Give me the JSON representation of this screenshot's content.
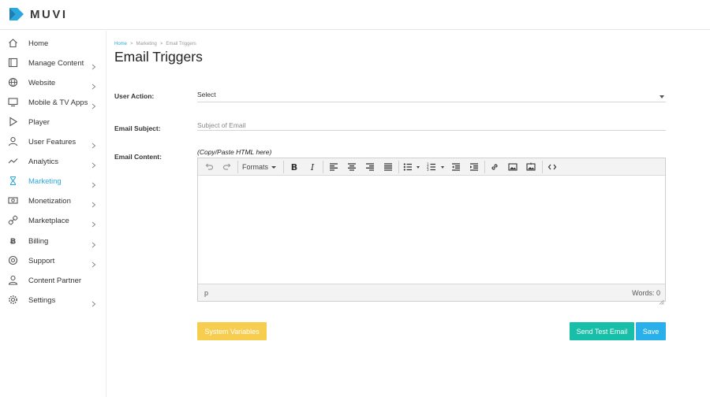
{
  "brand": {
    "name": "MUVI",
    "accent": "#29a8e0"
  },
  "sidebar": {
    "items": [
      {
        "label": "Home",
        "icon": "home-icon",
        "has_children": false,
        "active": false
      },
      {
        "label": "Manage Content",
        "icon": "film-icon",
        "has_children": true,
        "active": false
      },
      {
        "label": "Website",
        "icon": "globe-icon",
        "has_children": true,
        "active": false
      },
      {
        "label": "Mobile & TV Apps",
        "icon": "monitor-icon",
        "has_children": true,
        "active": false
      },
      {
        "label": "Player",
        "icon": "play-icon",
        "has_children": false,
        "active": false
      },
      {
        "label": "User Features",
        "icon": "user-icon",
        "has_children": true,
        "active": false
      },
      {
        "label": "Analytics",
        "icon": "trend-icon",
        "has_children": true,
        "active": false
      },
      {
        "label": "Marketing",
        "icon": "hourglass-icon",
        "has_children": true,
        "active": true
      },
      {
        "label": "Monetization",
        "icon": "money-icon",
        "has_children": true,
        "active": false
      },
      {
        "label": "Marketplace",
        "icon": "link-icon",
        "has_children": true,
        "active": false
      },
      {
        "label": "Billing",
        "icon": "bitcoin-icon",
        "has_children": true,
        "active": false
      },
      {
        "label": "Support",
        "icon": "lifebuoy-icon",
        "has_children": true,
        "active": false
      },
      {
        "label": "Content Partner",
        "icon": "partner-icon",
        "has_children": false,
        "active": false
      },
      {
        "label": "Settings",
        "icon": "gear-icon",
        "has_children": true,
        "active": false
      }
    ]
  },
  "breadcrumb": {
    "home": "Home",
    "section": "Marketing",
    "current": "Email Triggers",
    "separator": ">"
  },
  "page": {
    "title": "Email Triggers"
  },
  "form": {
    "user_action_label": "User Action:",
    "user_action_value": "Select",
    "subject_label": "Email Subject:",
    "subject_placeholder": "Subject of Email",
    "subject_value": "",
    "content_label": "Email Content:",
    "content_hint": "(Copy/Paste HTML here)"
  },
  "editor": {
    "formats_label": "Formats",
    "path": "p",
    "word_count": "Words: 0"
  },
  "buttons": {
    "system_variables": "System Variables",
    "send_test_email": "Send Test Email",
    "save": "Save"
  },
  "colors": {
    "system_variables_bg": "#f7cd4f",
    "send_test_bg": "#17bfa8",
    "save_bg": "#29b0ea"
  }
}
